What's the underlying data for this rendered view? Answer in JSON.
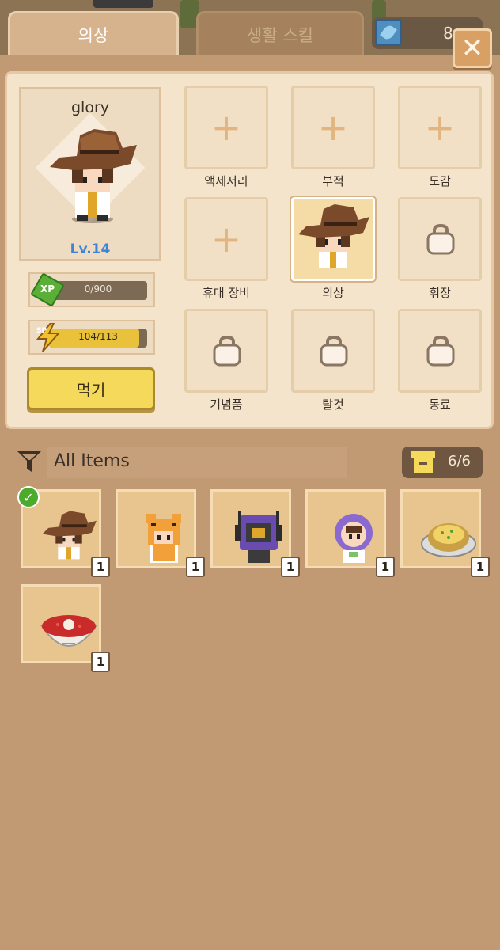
{
  "tabs": {
    "costume": "의상",
    "life_skill": "생활 스킬"
  },
  "currency": {
    "value": "8"
  },
  "close_glyph": "✕",
  "character": {
    "name": "glory",
    "level": "Lv.14"
  },
  "xp": {
    "badge": "XP",
    "text": "0/900",
    "fraction": 0.0
  },
  "sp": {
    "badge": "SP",
    "text": "104/113",
    "fraction": 0.92
  },
  "eat_button": "먹기",
  "equip_slots": [
    {
      "label": "액세서리",
      "state": "empty"
    },
    {
      "label": "부적",
      "state": "empty"
    },
    {
      "label": "도감",
      "state": "empty"
    },
    {
      "label": "휴대 장비",
      "state": "empty"
    },
    {
      "label": "의상",
      "state": "equipped"
    },
    {
      "label": "휘장",
      "state": "locked"
    },
    {
      "label": "기념품",
      "state": "locked"
    },
    {
      "label": "탈것",
      "state": "locked"
    },
    {
      "label": "동료",
      "state": "locked"
    }
  ],
  "plus_glyph": "+",
  "filter": {
    "label": "All Items"
  },
  "inventory_count": "6/6",
  "inventory": [
    {
      "item": "cowboy-hat-costume",
      "qty": "1",
      "equipped": true
    },
    {
      "item": "tiger-costume",
      "qty": "1",
      "equipped": false
    },
    {
      "item": "robot-costume",
      "qty": "1",
      "equipped": false
    },
    {
      "item": "astronaut-costume",
      "qty": "1",
      "equipped": false
    },
    {
      "item": "baked-potato",
      "qty": "1",
      "equipped": false
    },
    {
      "item": "borscht-soup-bowl",
      "qty": "1",
      "equipped": false
    }
  ],
  "check_glyph": "✓",
  "colors": {
    "background": "#c19972",
    "panel": "#f4e4cc",
    "eat_button": "#f4d95b",
    "sp_fill": "#e9c13b",
    "level": "#3c83d9",
    "check": "#4caa2d"
  }
}
